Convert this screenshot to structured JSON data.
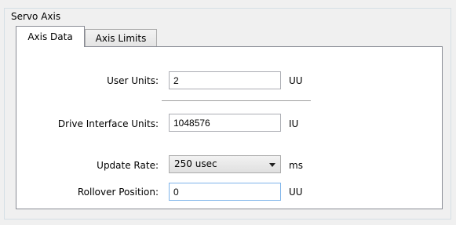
{
  "group": {
    "title": "Servo Axis"
  },
  "tabs": [
    {
      "label": "Axis Data",
      "active": true
    },
    {
      "label": "Axis Limits",
      "active": false
    }
  ],
  "fields": {
    "user_units": {
      "label": "User Units:",
      "value": "2",
      "unit": "UU"
    },
    "drive_interface_units": {
      "label": "Drive Interface Units:",
      "value": "1048576",
      "unit": "IU"
    },
    "update_rate": {
      "label": "Update Rate:",
      "value": "250 usec",
      "unit": "ms"
    },
    "rollover_position": {
      "label": "Rollover Position:",
      "value": "0",
      "unit": "UU"
    }
  }
}
